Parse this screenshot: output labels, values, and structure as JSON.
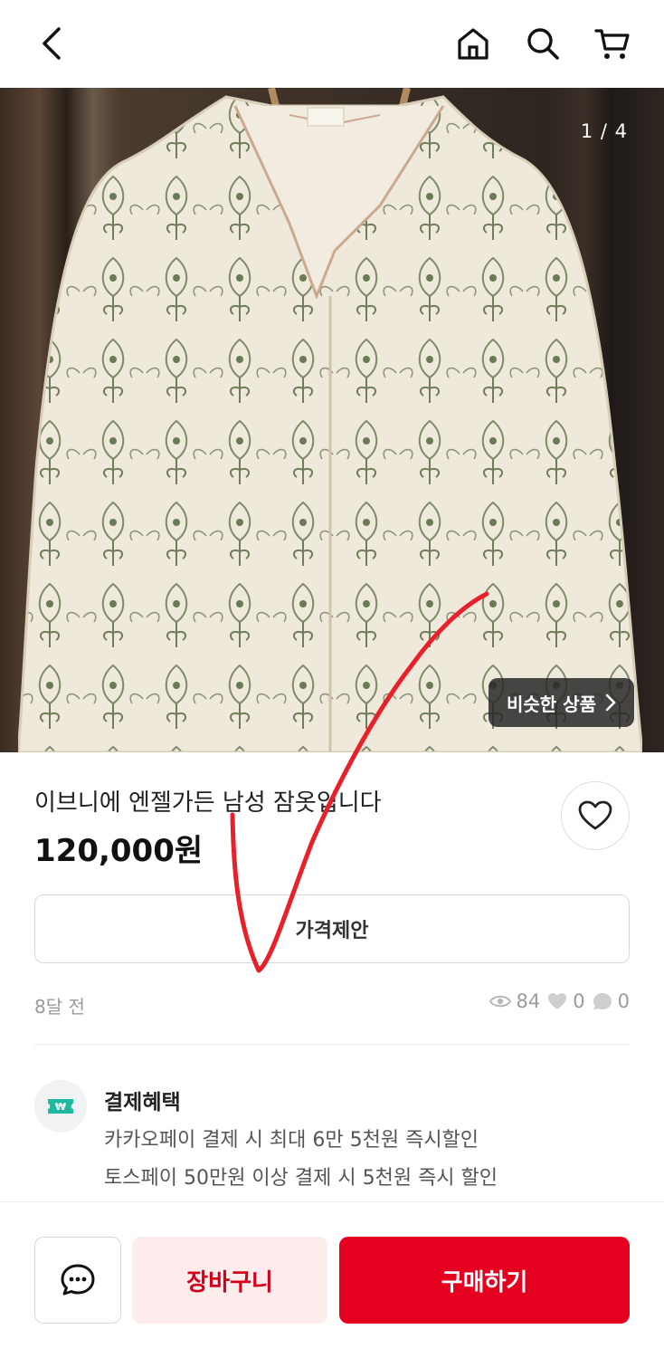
{
  "header": {
    "back_icon": "chevron-left-icon",
    "home_icon": "home-icon",
    "search_icon": "search-icon",
    "cart_icon": "cart-icon"
  },
  "gallery": {
    "counter": "1 / 4",
    "similar_label": "비슷한 상품",
    "similar_icon": "chevron-right-icon"
  },
  "product": {
    "title": "이브니에 엔젤가든 남성 잠옷입니다",
    "price": "120,000원",
    "offer_label": "가격제안",
    "posted": "8달 전",
    "views": "84",
    "likes": "0",
    "chats": "0"
  },
  "benefit": {
    "icon": "won-ticket-icon",
    "title": "결제혜택",
    "line1": "카카오페이 결제 시 최대 6만 5천원 즉시할인",
    "line2": "토스페이 50만원 이상 결제 시 5천원 즉시 할인"
  },
  "actions": {
    "chat_icon": "chat-bubble-icon",
    "cart_label": "장바구니",
    "buy_label": "구매하기"
  },
  "colors": {
    "brand": "#e4001e",
    "cart_bg": "#fdecec",
    "annotation": "#e8202a"
  }
}
